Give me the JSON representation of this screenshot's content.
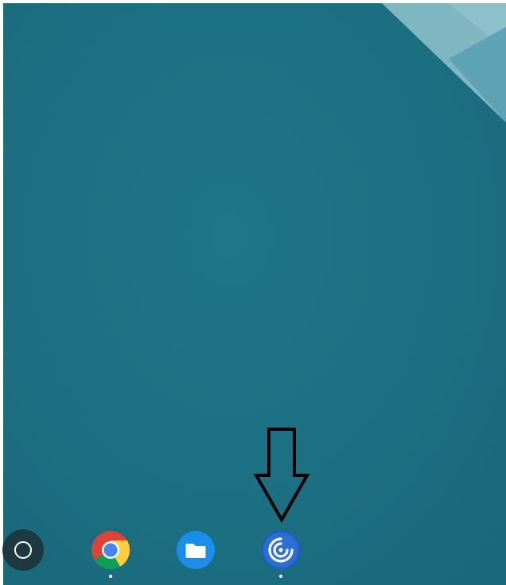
{
  "desktop": {
    "wallpaper_color": "#1c6f82",
    "wallpaper_accent": "#7fb9c5"
  },
  "shelf": {
    "launcher_icon": "launcher-circle-icon",
    "apps": [
      {
        "name": "chrome",
        "icon": "chrome-icon",
        "running": true
      },
      {
        "name": "files",
        "icon": "files-folder-icon",
        "running": false
      },
      {
        "name": "citrix-workspace",
        "icon": "citrix-workspace-icon",
        "running": true
      }
    ]
  },
  "annotation": {
    "arrow_icon": "down-arrow-icon",
    "arrow_color": "#000000"
  }
}
